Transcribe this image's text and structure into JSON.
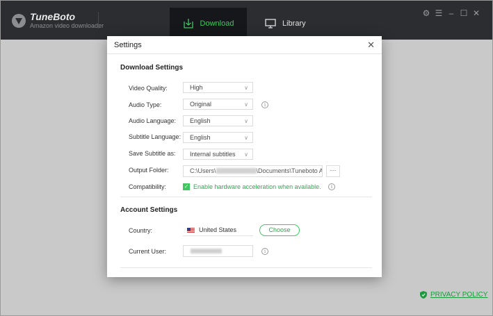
{
  "app": {
    "brand": "TuneBoto",
    "brand_subtitle": "Amazon video downloader",
    "tabs": [
      {
        "label": "Download",
        "icon": "download-icon",
        "active": true
      },
      {
        "label": "Library",
        "icon": "monitor-icon",
        "active": false
      }
    ],
    "window_controls": [
      "gear-icon",
      "menu-icon",
      "minimize-icon",
      "maximize-icon",
      "close-icon"
    ],
    "privacy_policy": "PRIVACY POLICY",
    "accent_color": "#3ec95f"
  },
  "dialog": {
    "title": "Settings",
    "download_section": {
      "title": "Download Settings",
      "video_quality": {
        "label": "Video Quality:",
        "value": "High"
      },
      "audio_type": {
        "label": "Audio Type:",
        "value": "Original"
      },
      "audio_language": {
        "label": "Audio Language:",
        "value": "English"
      },
      "subtitle_language": {
        "label": "Subtitle Language:",
        "value": "English"
      },
      "save_subtitle": {
        "label": "Save Subtitle as:",
        "value": "Internal subtitles"
      },
      "output_folder": {
        "label": "Output Folder:",
        "path_prefix": "C:\\Users\\",
        "path_suffix": "\\Documents\\Tuneboto Ar",
        "browse_label": "···"
      },
      "compatibility": {
        "label": "Compatibility:",
        "checked": true,
        "text": "Enable hardware acceleration when available."
      }
    },
    "account_section": {
      "title": "Account Settings",
      "country": {
        "label": "Country:",
        "value": "United States"
      },
      "choose_label": "Choose",
      "current_user": {
        "label": "Current User:"
      }
    }
  }
}
